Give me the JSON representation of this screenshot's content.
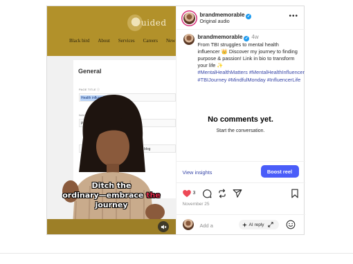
{
  "media": {
    "site_logo_text": "uided",
    "site_nav": [
      "Black bird",
      "About",
      "Services",
      "Careers",
      "New"
    ],
    "settings_heading": "General",
    "fields": [
      {
        "label": "PAGE TITLE",
        "value": "Health influencers posts"
      },
      {
        "label": "NAVIGATION TITLE",
        "value": "Posts"
      },
      {
        "label": "",
        "value": "blog"
      }
    ],
    "caption": {
      "line1": "Ditch the",
      "line2_a": "ordinary—embrace ",
      "line2_b": "the",
      "line3": "journey"
    },
    "mute_icon": "speaker-muted-icon"
  },
  "header": {
    "username": "brandmemorable",
    "audio": "Original audio"
  },
  "post": {
    "username": "brandmemorable",
    "age": "4w",
    "caption": "From TBI struggles to mental health influencer 👑 Discover my journey to finding purpose & passion! Link in bio to transform your life ✨",
    "hashtags": "#MentalHealthMatters #MentalHealthInfluencer #TBIJourney #MindfulMonday #InfluencerLife"
  },
  "comments": {
    "empty_title": "No comments yet.",
    "empty_sub": "Start the conversation."
  },
  "insights": {
    "view_label": "View insights",
    "boost_label": "Boost reel"
  },
  "actions": {
    "like_count": "3",
    "date": "November 25"
  },
  "comment_bar": {
    "placeholder": "Add a",
    "ai_label": "AI reply"
  },
  "colors": {
    "accent_blue": "#4a5df9",
    "link_blue": "#3847a8",
    "like_red": "#ed4956",
    "site_gold": "#b2912a"
  }
}
